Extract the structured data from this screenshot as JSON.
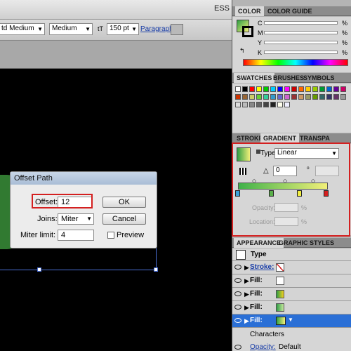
{
  "topbar": {
    "workspace": "ESS"
  },
  "control_bar": {
    "font_style": "td Medium",
    "weight": "Medium",
    "size": "150 pt",
    "paragraph_label": "Paragraph:"
  },
  "color_panel": {
    "tabs": [
      "COLOR",
      "COLOR GUIDE"
    ],
    "sliders": [
      {
        "label": "C",
        "unit": "%"
      },
      {
        "label": "M",
        "unit": "%"
      },
      {
        "label": "Y",
        "unit": "%"
      },
      {
        "label": "K",
        "unit": "%"
      }
    ]
  },
  "swatches_panel": {
    "tabs": [
      "SWATCHES",
      "BRUSHES",
      "SYMBOLS"
    ]
  },
  "gradient_panel": {
    "tabs": [
      "STROKE",
      "GRADIENT",
      "TRANSPA"
    ],
    "type_label": "Type:",
    "type_value": "Linear",
    "angle_value": "0",
    "opacity_label": "Opacity:",
    "location_label": "Location:",
    "unit": "%"
  },
  "appearance_panel": {
    "tabs": [
      "APPEARANCE",
      "GRAPHIC STYLES"
    ],
    "header": "Type",
    "rows": [
      "Stroke:",
      "Fill:",
      "Fill:",
      "Fill:",
      "Fill:"
    ],
    "characters": "Characters",
    "opacity_label": "Opacity:",
    "opacity_value": "Default"
  },
  "dialog": {
    "title": "Offset Path",
    "offset_label": "Offset:",
    "offset_value": "12",
    "joins_label": "Joins:",
    "joins_value": "Miter",
    "miter_label": "Miter limit:",
    "miter_value": "4",
    "ok": "OK",
    "cancel": "Cancel",
    "preview": "Preview"
  },
  "colors": {
    "highlight": "#d42020",
    "selection": "#2a6fd6",
    "gradient_start": "#2f9e44",
    "gradient_end": "#f2f07a"
  }
}
